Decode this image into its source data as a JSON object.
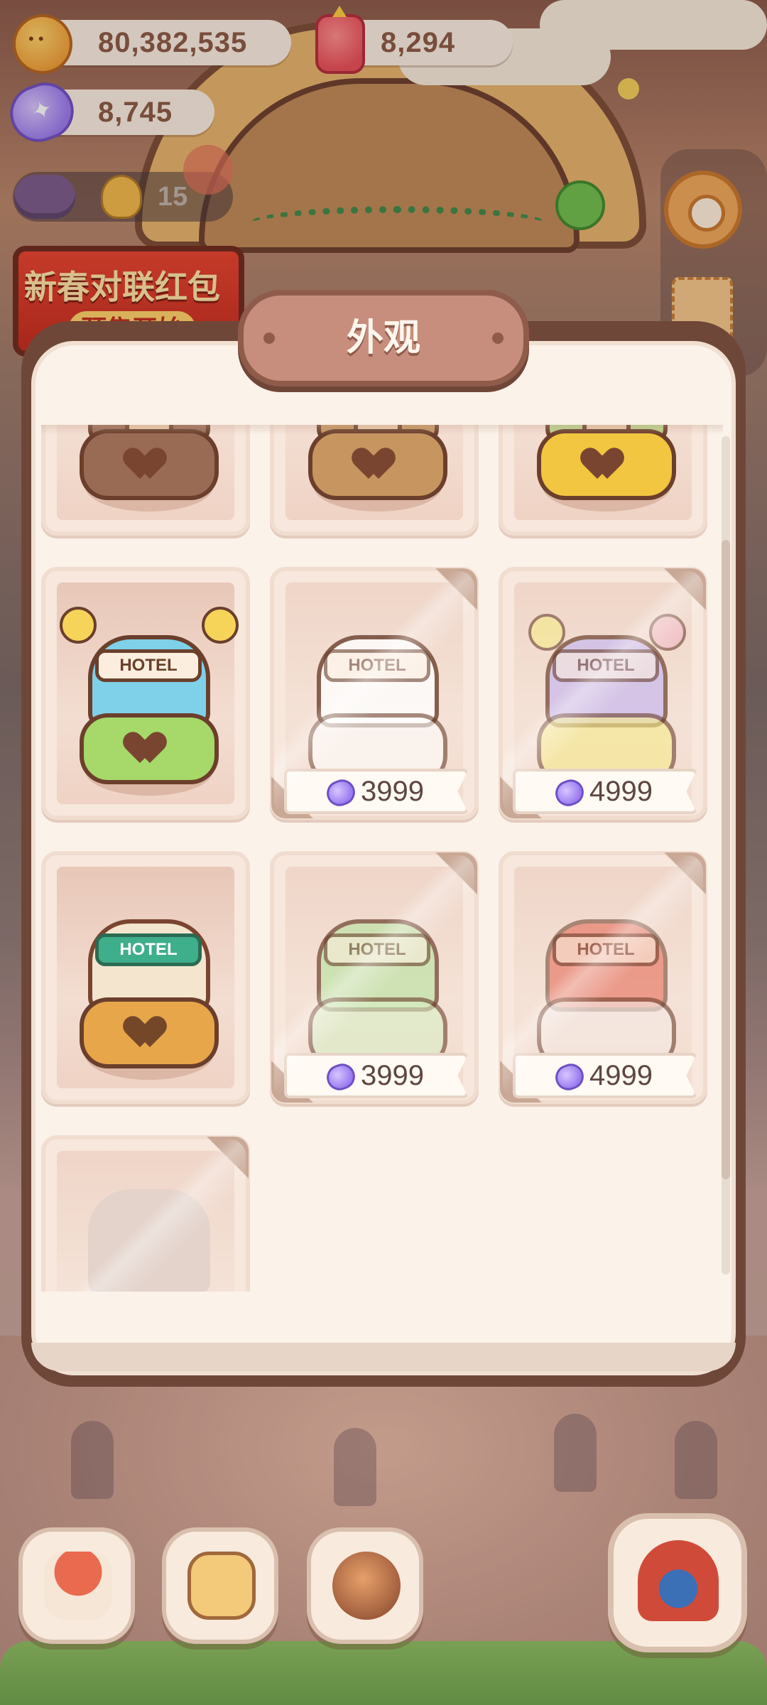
{
  "currency": {
    "cookies": "80,382,535",
    "lanterns": "8,294",
    "candies": "8,745"
  },
  "friends": {
    "count": "15"
  },
  "event_banner": {
    "title": "新春对联红包",
    "subtitle": "预售开始"
  },
  "dialog": {
    "title": "外观"
  },
  "skins": [
    {
      "id": "brown-classic",
      "state": "owned",
      "body_color": "#9a6b54",
      "base_color": "#9a6b54"
    },
    {
      "id": "tan-classic",
      "state": "owned",
      "body_color": "#c7955f",
      "base_color": "#c7955f"
    },
    {
      "id": "lemon-flower",
      "state": "owned",
      "body_color": "#b9d38a",
      "base_color": "#f2c640"
    },
    {
      "id": "olympic-balloon-hotel",
      "state": "owned",
      "sign": "HOTEL",
      "body_color": "#7fd0e9",
      "base_color": "#a6d86a"
    },
    {
      "id": "white-blossom-hotel",
      "state": "locked",
      "sign": "HOTEL",
      "price": "3999",
      "body_color": "#ffffff",
      "base_color": "#ffffff"
    },
    {
      "id": "pastel-balloon-hotel",
      "state": "locked",
      "sign": "HOTEL",
      "price": "4999",
      "body_color": "#c8b9ef",
      "base_color": "#f6ec8a"
    },
    {
      "id": "candy-gingerbread-hotel",
      "state": "owned",
      "sign": "HOTEL",
      "body_color": "#f4e5cf",
      "base_color": "#e8a64a"
    },
    {
      "id": "green-garden-hotel",
      "state": "locked",
      "sign": "HOTEL",
      "price": "3999",
      "body_color": "#bfe3a6",
      "base_color": "#d8efc6"
    },
    {
      "id": "red-flower-hotel",
      "state": "locked",
      "sign": "HOTEL",
      "price": "4999",
      "body_color": "#e5634f",
      "base_color": "#f4e9e4"
    },
    {
      "id": "mystery-silhouette",
      "state": "locked"
    }
  ],
  "bottom_nav": [
    {
      "id": "home",
      "icon": "mushroom-house-icon"
    },
    {
      "id": "calendar",
      "icon": "heart-calendar-icon"
    },
    {
      "id": "character",
      "icon": "character-icon"
    },
    {
      "id": "theater",
      "icon": "theater-stage-icon"
    }
  ]
}
